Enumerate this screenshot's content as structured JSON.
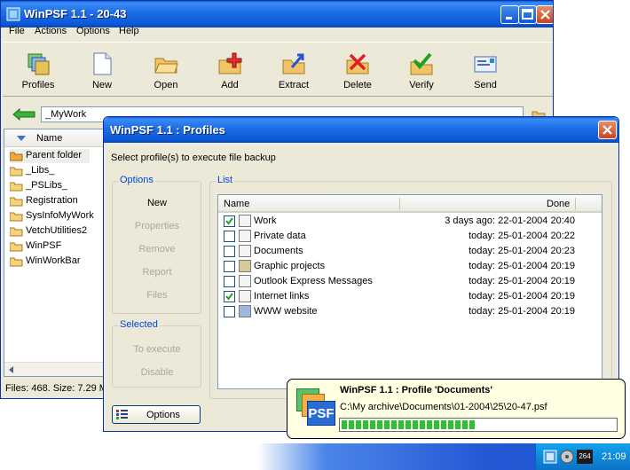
{
  "main_window": {
    "title": "WinPSF 1.1 - 20-43",
    "menu": [
      "File",
      "Actions",
      "Options",
      "Help"
    ],
    "toolbar": [
      "Profiles",
      "New",
      "Open",
      "Add",
      "Extract",
      "Delete",
      "Verify",
      "Send"
    ],
    "address": "_MyWork",
    "column_name": "Name",
    "files": [
      "Parent folder",
      "_Libs_",
      "_PSLibs_",
      "Registration",
      "SysInfoMyWork",
      "VetchUtilities2",
      "WinPSF",
      "WinWorkBar"
    ],
    "status": "Files: 468. Size: 7.29 M"
  },
  "dialog": {
    "title": "WinPSF 1.1 : Profiles",
    "instruction": "Select profile(s) to execute file backup",
    "options_group": "Options",
    "option_buttons": [
      {
        "label": "New",
        "enabled": true
      },
      {
        "label": "Properties",
        "enabled": false
      },
      {
        "label": "Remove",
        "enabled": false
      },
      {
        "label": "Report",
        "enabled": false
      },
      {
        "label": "Files",
        "enabled": false
      }
    ],
    "selected_group": "Selected",
    "selected_buttons": [
      {
        "label": "To execute",
        "enabled": false
      },
      {
        "label": "Disable",
        "enabled": false
      }
    ],
    "list_group": "List",
    "list_headers": {
      "name": "Name",
      "done": "Done"
    },
    "profiles": [
      {
        "checked": true,
        "name": "Work",
        "done": "3 days ago: 22-01-2004 20:40"
      },
      {
        "checked": false,
        "name": "Private data",
        "done": "today: 25-01-2004 20:22"
      },
      {
        "checked": false,
        "name": "Documents",
        "done": "today: 25-01-2004 20:23"
      },
      {
        "checked": false,
        "name": "Graphic projects",
        "done": "today: 25-01-2004 20:19"
      },
      {
        "checked": false,
        "name": "Outlook Express Messages",
        "done": "today: 25-01-2004 20:19"
      },
      {
        "checked": true,
        "name": "Internet links",
        "done": "today: 25-01-2004 20:19"
      },
      {
        "checked": false,
        "name": "WWW website",
        "done": "today: 25-01-2004 20:19"
      }
    ],
    "options_button": "Options"
  },
  "popup": {
    "logo": "PSF",
    "title": "WinPSF 1.1 : Profile 'Documents'",
    "path": "C:\\My archive\\Documents\\01-2004\\25\\20-47.psf",
    "progress": 0.5
  },
  "taskbar": {
    "clock": "21:09",
    "tray_badge": "264"
  },
  "colors": {
    "xp_blue": "#0a58d6",
    "face": "#ece9d8",
    "group_title": "#0046d5",
    "progress": "#2cc02c",
    "popup_bg": "#ffffe1"
  }
}
